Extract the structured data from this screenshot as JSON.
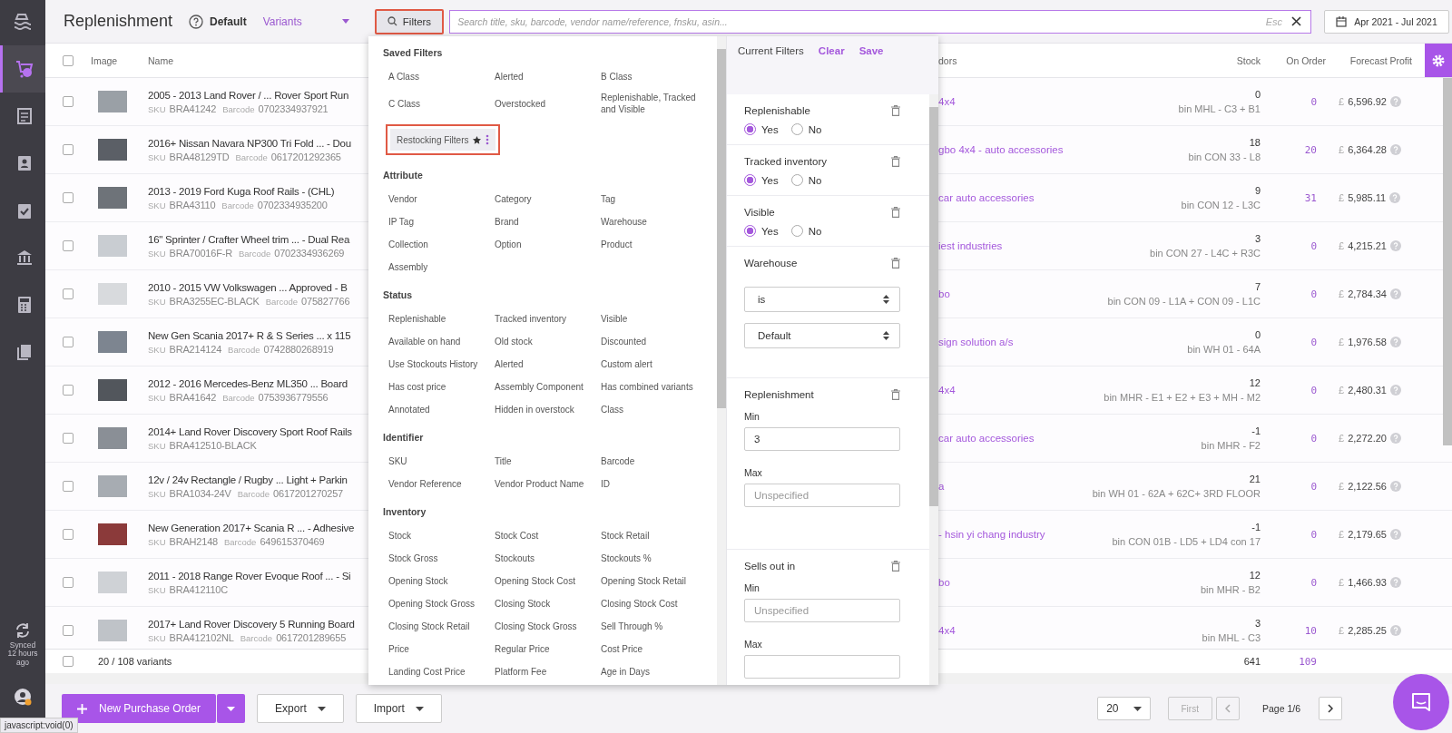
{
  "sidebar": {
    "items": [
      {
        "selected": true
      },
      {
        "selected": false
      },
      {
        "selected": false
      },
      {
        "selected": false
      },
      {
        "selected": false
      },
      {
        "selected": false
      },
      {
        "selected": false
      }
    ],
    "sync_label": "Synced 12 hours ago"
  },
  "header": {
    "title": "Replenishment",
    "view": "Default",
    "mode": "Variants",
    "filters_button": {
      "label": "Filters",
      "highlighted": true
    },
    "search": {
      "placeholder": "Search title, sku, barcode, vendor name/reference, fnsku, asin...",
      "esc_hint": "Esc"
    },
    "date_range": "Apr 2021 - Jul 2021"
  },
  "table": {
    "select_all_checked": false,
    "columns": [
      "Image",
      "Name",
      "dors",
      "Stock",
      "On Order",
      "Forecast Profit"
    ],
    "rows": [
      {
        "checked": false,
        "name": "2005 - 2013 Land Rover / ... Rover Sport Run",
        "sku_label": "SKU",
        "sku": "BRA41242",
        "barcode_label": "Barcode",
        "barcode": "0702334937921",
        "vendor": "4x4",
        "stock": "0",
        "bin": "bin MHL - C3 + B1",
        "on_order": "0",
        "currency": "£",
        "profit": "6,596.92"
      },
      {
        "checked": false,
        "name": "2016+ Nissan Navara NP300 Tri Fold ... - Dou",
        "sku_label": "SKU",
        "sku": "BRA48129TD",
        "barcode_label": "Barcode",
        "barcode": "0617201292365",
        "vendor": "gbo 4x4 - auto accessories",
        "stock": "18",
        "bin": "bin CON 33 - L8",
        "on_order": "20",
        "currency": "£",
        "profit": "6,364.28"
      },
      {
        "checked": false,
        "name": "2013 - 2019 Ford Kuga Roof Rails - (CHL)",
        "sku_label": "SKU",
        "sku": "BRA43110",
        "barcode_label": "Barcode",
        "barcode": "0702334935200",
        "vendor": "car auto accessories",
        "stock": "9",
        "bin": "bin CON 12 - L3C",
        "on_order": "31",
        "currency": "£",
        "profit": "5,985.11"
      },
      {
        "checked": false,
        "name": "16\" Sprinter / Crafter Wheel trim ... - Dual Rea",
        "sku_label": "SKU",
        "sku": "BRA70016F-R",
        "barcode_label": "Barcode",
        "barcode": "0702334936269",
        "vendor": "iest industries",
        "stock": "3",
        "bin": "bin CON 27 - L4C + R3C",
        "on_order": "0",
        "currency": "£",
        "profit": "4,215.21"
      },
      {
        "checked": false,
        "name": "2010 - 2015 VW Volkswagen ... Approved - B",
        "sku_label": "SKU",
        "sku": "BRA3255EC-BLACK",
        "barcode_label": "Barcode",
        "barcode": "075827766",
        "vendor": "bo",
        "stock": "7",
        "bin": "bin CON 09 - L1A + CON 09 - L1C",
        "on_order": "0",
        "currency": "£",
        "profit": "2,784.34"
      },
      {
        "checked": false,
        "name": "New Gen Scania 2017+ R & S Series ... x 115",
        "sku_label": "SKU",
        "sku": "BRA214124",
        "barcode_label": "Barcode",
        "barcode": "0742880268919",
        "vendor": "sign solution a/s",
        "stock": "0",
        "bin": "bin WH 01 - 64A",
        "on_order": "0",
        "currency": "£",
        "profit": "1,976.58"
      },
      {
        "checked": false,
        "name": "2012 - 2016 Mercedes-Benz ML350 ... Board",
        "sku_label": "SKU",
        "sku": "BRA41642",
        "barcode_label": "Barcode",
        "barcode": "0753936779556",
        "vendor": "4x4",
        "stock": "12",
        "bin": "bin MHR - E1 + E2 + E3 + MH - M2",
        "on_order": "0",
        "currency": "£",
        "profit": "2,480.31"
      },
      {
        "checked": false,
        "name": "2014+ Land Rover Discovery Sport Roof Rails",
        "sku_label": "SKU",
        "sku": "BRA412510-BLACK",
        "vendor": "car auto accessories",
        "stock": "-1",
        "bin": "bin MHR - F2",
        "on_order": "0",
        "currency": "£",
        "profit": "2,272.20"
      },
      {
        "checked": false,
        "name": "12v / 24v Rectangle / Rugby ... Light + Parkin",
        "sku_label": "SKU",
        "sku": "BRA1034-24V",
        "barcode_label": "Barcode",
        "barcode": "0617201270257",
        "vendor": "a",
        "stock": "21",
        "bin": "bin WH 01 - 62A + 62C+ 3RD FLOOR",
        "on_order": "0",
        "currency": "£",
        "profit": "2,122.56"
      },
      {
        "checked": false,
        "name": "New Generation 2017+ Scania R ... - Adhesive",
        "sku_label": "SKU",
        "sku": "BRAH2148",
        "barcode_label": "Barcode",
        "barcode": "649615370469",
        "vendor": "- hsin yi chang industry",
        "stock": "-1",
        "bin": "bin CON 01B - LD5 + LD4 con 17",
        "on_order": "0",
        "currency": "£",
        "profit": "2,179.65"
      },
      {
        "checked": false,
        "name": "2011 - 2018 Range Rover Evoque Roof ... - Si",
        "sku_label": "SKU",
        "sku": "BRA412110C",
        "vendor": "bo",
        "stock": "12",
        "bin": "bin MHR - B2",
        "on_order": "0",
        "currency": "£",
        "profit": "1,466.93"
      },
      {
        "checked": false,
        "name": "2017+ Land Rover Discovery 5 Running Board",
        "sku_label": "SKU",
        "sku": "BRA412102NL",
        "barcode_label": "Barcode",
        "barcode": "0617201289655",
        "vendor": "4x4",
        "stock": "3",
        "bin": "bin MHL - C3",
        "on_order": "10",
        "currency": "£",
        "profit": "2,285.25"
      }
    ],
    "footer": {
      "checked": false,
      "count": "20 / 108 variants",
      "stock_total": "641",
      "on_order_total": "109"
    }
  },
  "filter_menu": {
    "saved": {
      "title": "Saved Filters",
      "items": [
        "A Class",
        "Alerted",
        "B Class",
        "C Class",
        "Overstocked",
        "Replenishable, Tracked and Visible"
      ],
      "pinned": {
        "label": "Restocking Filters",
        "starred": true,
        "highlighted": true
      }
    },
    "sections": [
      {
        "title": "Attribute",
        "items": [
          "Vendor",
          "Category",
          "Tag",
          "IP Tag",
          "Brand",
          "Warehouse",
          "Collection",
          "Option",
          "Product",
          "Assembly"
        ]
      },
      {
        "title": "Status",
        "items": [
          "Replenishable",
          "Tracked inventory",
          "Visible",
          "Available on hand",
          "Old stock",
          "Discounted",
          "Use Stockouts History",
          "Alerted",
          "Custom alert",
          "Has cost price",
          "Assembly Component",
          "Has combined variants",
          "Annotated",
          "Hidden in overstock",
          "Class"
        ]
      },
      {
        "title": "Identifier",
        "items": [
          "SKU",
          "Title",
          "Barcode",
          "Vendor Reference",
          "Vendor Product Name",
          "ID"
        ]
      },
      {
        "title": "Inventory",
        "items": [
          "Stock",
          "Stock Cost",
          "Stock Retail",
          "Stock Gross",
          "Stockouts",
          "Stockouts %",
          "Opening Stock",
          "Opening Stock Cost",
          "Opening Stock Retail",
          "Opening Stock Gross",
          "Closing Stock",
          "Closing Stock Cost",
          "Closing Stock Retail",
          "Closing Stock Gross",
          "Sell Through %",
          "Price",
          "Regular Price",
          "Cost Price",
          "Landing Cost Price",
          "Platform Fee",
          "Age in Days"
        ]
      }
    ]
  },
  "current_filters": {
    "title": "Current Filters",
    "clear": "Clear",
    "save": "Save",
    "filters": [
      {
        "kind": "radio",
        "title": "Replenishable",
        "options": [
          {
            "label": "Yes",
            "selected": true
          },
          {
            "label": "No",
            "selected": false
          }
        ]
      },
      {
        "kind": "radio",
        "title": "Tracked inventory",
        "options": [
          {
            "label": "Yes",
            "selected": true
          },
          {
            "label": "No",
            "selected": false
          }
        ]
      },
      {
        "kind": "radio",
        "title": "Visible",
        "options": [
          {
            "label": "Yes",
            "selected": true
          },
          {
            "label": "No",
            "selected": false
          }
        ]
      },
      {
        "kind": "select",
        "title": "Warehouse",
        "selects": [
          "is",
          "Default"
        ]
      },
      {
        "kind": "range",
        "title": "Replenishment",
        "min": {
          "label": "Min",
          "value": "3"
        },
        "max": {
          "label": "Max",
          "placeholder": "Unspecified"
        }
      },
      {
        "kind": "range",
        "title": "Sells out in",
        "min": {
          "label": "Min",
          "placeholder": "Unspecified"
        },
        "max": {
          "label": "Max"
        }
      }
    ]
  },
  "bottom_bar": {
    "new_order": "New Purchase Order",
    "export": "Export",
    "import": "Import",
    "page_size": "20",
    "first": {
      "label": "First",
      "disabled": true
    },
    "page": "Page 1/6"
  },
  "status_url": "javascript:void(0)"
}
